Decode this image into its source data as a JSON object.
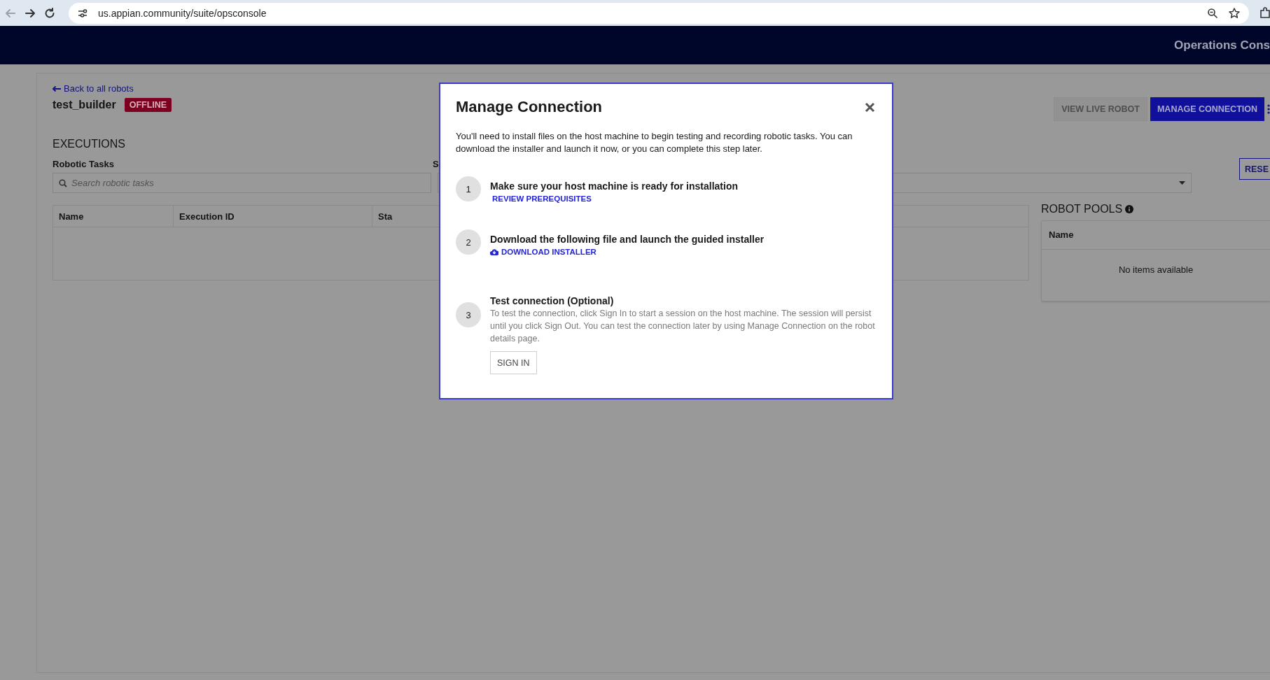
{
  "browser": {
    "url": "us.appian.community/suite/opsconsole"
  },
  "header": {
    "title": "Operations Cons"
  },
  "page": {
    "back_link": "Back to all robots",
    "robot_name": "test_builder",
    "status_badge": "OFFLINE",
    "buttons": [
      {
        "label": "VIEW LIVE ROBOT",
        "disabled": true
      },
      {
        "label": "MANAGE CONNECTION",
        "disabled": false
      }
    ],
    "section_title": "EXECUTIONS",
    "filters": [
      {
        "label": "Robotic Tasks",
        "placeholder": "Search robotic tasks",
        "kind": "search"
      },
      {
        "label": "S",
        "kind": "dropdown"
      }
    ],
    "reset_button": "RESE",
    "table": {
      "columns": [
        "Name",
        "Execution ID",
        "Sta"
      ]
    },
    "robot_pools": {
      "title": "ROBOT POOLS",
      "columns": [
        "Name"
      ],
      "empty_text": "No items available"
    }
  },
  "modal": {
    "title": "Manage Connection",
    "intro": "You'll need to install files on the host machine to begin testing and recording robotic tasks. You can download the installer and launch it now, or you can complete this step later.",
    "steps": [
      {
        "number": "1",
        "kind": "link",
        "title": "Make sure your host machine is ready for installation",
        "link": "REVIEW PREREQUISITES"
      },
      {
        "number": "2",
        "kind": "download",
        "title": "Download the following file and launch the guided installer",
        "link": "DOWNLOAD INSTALLER"
      },
      {
        "number": "3",
        "kind": "test",
        "title": "Test connection (Optional)",
        "description": "To test the connection, click Sign In to start a session on the host machine. The session will persist until you click Sign Out. You can test the connection later by using Manage Connection on the robot details page.",
        "button": "SIGN IN"
      }
    ]
  }
}
